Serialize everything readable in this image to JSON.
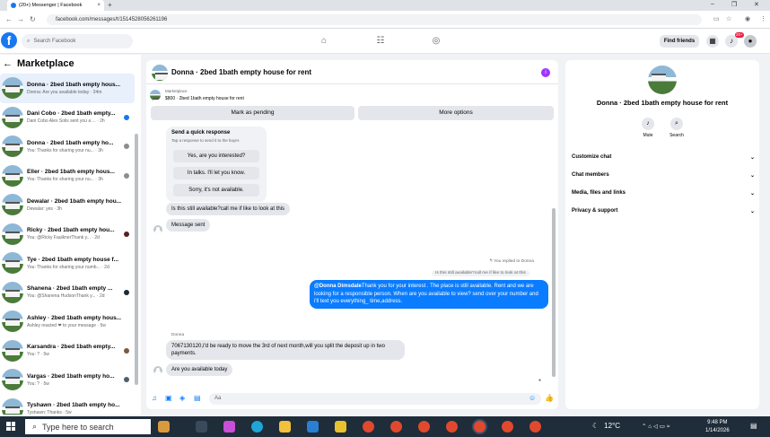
{
  "browser": {
    "tab_title": "(20+) Messenger | Facebook",
    "url": "facebook.com/messages/t/1514528056261196",
    "new_tab": "+",
    "tab_close": "×",
    "win_min": "–",
    "win_max": "❐",
    "win_close": "✕"
  },
  "header": {
    "search_placeholder": "Search Facebook",
    "find_friends": "Find friends",
    "notif_badge": "20+"
  },
  "sidebar": {
    "title": "Marketplace",
    "conversations": [
      {
        "title": "Donna · 2bed 1bath empty hous...",
        "sub": "Donna: Are you available today · 34m",
        "active": true
      },
      {
        "title": "Dani Cobo · 2bed 1bath empty...",
        "sub": "Dani Cobo Alex Solis sent you a ... · 2h"
      },
      {
        "title": "Donna · 2bed 1bath empty ho...",
        "sub": "You: Thanks for sharing your nu... · 3h"
      },
      {
        "title": "Eller · 2bed 1bath empty hous...",
        "sub": "You: Thanks for sharing your nu... · 3h"
      },
      {
        "title": "Dewalar · 2bed 1bath empty hou...",
        "sub": "Dewalar: yes · 3h"
      },
      {
        "title": "Ricky · 2bed 1bath empty hou...",
        "sub": "You: @Ricky FaulknerThank y... · 2d"
      },
      {
        "title": "Tye · 2bed 1bath empty house f...",
        "sub": "You: Thanks for sharing your numb... · 2d"
      },
      {
        "title": "Shanena · 2bed 1bath empty ...",
        "sub": "You: @Shanena HudsonThank y... · 2d"
      },
      {
        "title": "Ashley · 2bed 1bath empty hous...",
        "sub": "Ashley reacted ❤ to your message · 5w"
      },
      {
        "title": "Karsandra · 2bed 1bath empty...",
        "sub": "You: ? · 5w"
      },
      {
        "title": "Vargas · 2bed 1bath empty ho...",
        "sub": "You: ? · 5w"
      },
      {
        "title": "Tyshawn · 2bed 1bath empty ho...",
        "sub": "Tyshawn: Thanks · 5w"
      }
    ]
  },
  "chat": {
    "title": "Donna · 2bed 1bath empty house for rent",
    "listing_label": "Marketplace",
    "listing_price": "$800 · 2bed 1bath empty house for rent",
    "mark_pending": "Mark as pending",
    "more_options": "More options",
    "quick_title": "Send a quick response",
    "quick_sub": "Tap a response to send it to the buyer.",
    "quick_1": "Yes, are you interested?",
    "quick_2": "In talks. I'll let you know.",
    "quick_3": "Sorry, it's not available.",
    "msg_available": "Is this still available?call me if like to look at this",
    "msg_sent": "Message sent",
    "replied": "You replied to Donna",
    "quoted": "Is this still available?call me if like to look at this",
    "my_mention": "@Donna Dimsdale",
    "my_text": "Thank you for your interest . The place is still available. Rent and we are looking for a responsible person. When are you available to view? send over your number and i'll text you everything_ time,address.",
    "donna_name": "Donna",
    "donna_msg": "7067130120,I'd be ready to move the 3rd of next month,will you split the deposit up in two payments.",
    "last_msg": "Are you available today",
    "composer_placeholder": "Aa"
  },
  "details": {
    "title": "Donna · 2bed 1bath empty house for rent",
    "mute": "Mute",
    "search": "Search",
    "rows": [
      "Customize chat",
      "Chat members",
      "Media, files and links",
      "Privacy & support"
    ]
  },
  "taskbar": {
    "search_placeholder": "Type here to search",
    "temp": "12°C",
    "time": "9:48 PM",
    "date": "1/14/2026"
  },
  "colors": {
    "accent": "#0a7cff",
    "fb_blue": "#1877f2",
    "badge": "#e41e3f"
  }
}
